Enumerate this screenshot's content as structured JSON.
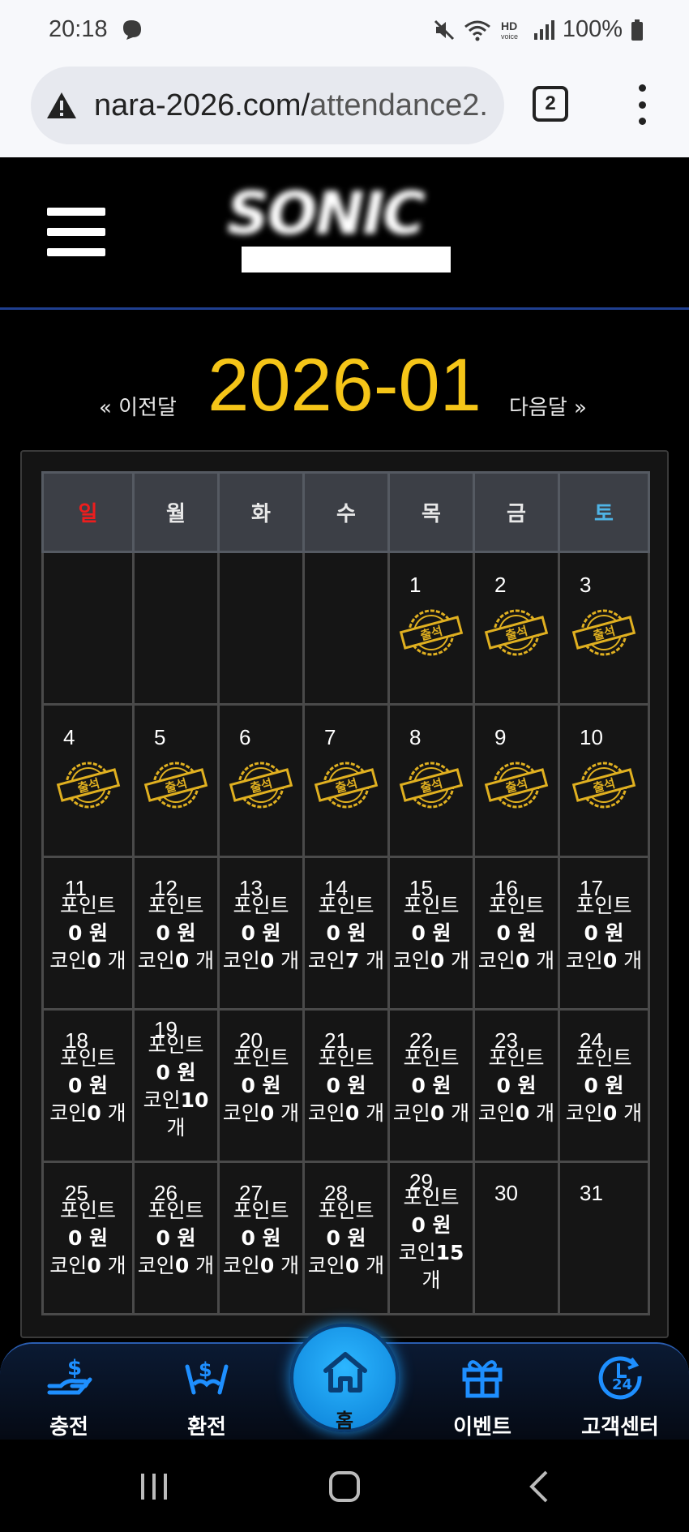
{
  "status": {
    "time": "20:18",
    "battery": "100%",
    "icons": [
      "threads-icon",
      "mute-icon",
      "wifi-icon",
      "hd-voice-icon",
      "signal-icon",
      "battery-icon"
    ]
  },
  "browser": {
    "url_main": "nara-2026.com/",
    "url_rest": "attendance2.",
    "tab_count": "2"
  },
  "header": {
    "logo_text": "SONIC"
  },
  "calendar": {
    "prev_label": "« 이전달",
    "month": "2026-01",
    "next_label": "다음달 »",
    "weekdays": [
      "일",
      "월",
      "화",
      "수",
      "목",
      "금",
      "토"
    ]
  },
  "days": {
    "d1": "1",
    "d2": "2",
    "d3": "3",
    "d4": "4",
    "d5": "5",
    "d6": "6",
    "d7": "7",
    "d8": "8",
    "d9": "9",
    "d10": "10",
    "d11": "11",
    "d12": "12",
    "d13": "13",
    "d14": "14",
    "d15": "15",
    "d16": "16",
    "d17": "17",
    "d18": "18",
    "d19": "19",
    "d20": "20",
    "d21": "21",
    "d22": "22",
    "d23": "23",
    "d24": "24",
    "d25": "25",
    "d26": "26",
    "d27": "27",
    "d28": "28",
    "d29": "29",
    "d30": "30",
    "d31": "31"
  },
  "stamp_label": "출석",
  "labels": {
    "point": "포인트",
    "won": "0 원",
    "coin": "코인",
    "unit": "개"
  },
  "coins": {
    "c11": "0",
    "c12": "0",
    "c13": "0",
    "c14": "7",
    "c15": "0",
    "c16": "0",
    "c17": "0",
    "c18": "0",
    "c19": "10",
    "c20": "0",
    "c21": "0",
    "c22": "0",
    "c23": "0",
    "c24": "0",
    "c25": "0",
    "c26": "0",
    "c27": "0",
    "c28": "0",
    "c29": "15"
  },
  "bottomnav": {
    "charge": "충전",
    "exchange": "환전",
    "home": "홈",
    "event": "이벤트",
    "support": "고객센터"
  },
  "colors": {
    "month": "#f5c518",
    "sunday": "#ee1d1d",
    "saturday": "#4fb4e6",
    "stamp": "#e0b020",
    "nav_icon": "#1e8fff"
  }
}
